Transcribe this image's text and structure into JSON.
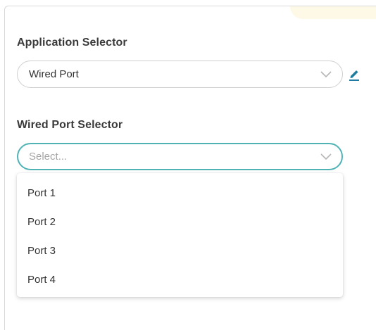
{
  "form": {
    "application_selector": {
      "label": "Application Selector",
      "value": "Wired Port",
      "icon": "chevron-down-icon",
      "edit_icon": "pencil-edit-icon"
    },
    "wired_port_selector": {
      "label": "Wired Port Selector",
      "placeholder": "Select...",
      "icon": "chevron-down-icon",
      "options": [
        "Port 1",
        "Port 2",
        "Port 3",
        "Port 4"
      ]
    }
  },
  "colors": {
    "focus_border": "#4fb3b6",
    "accent": "#1f7c9e",
    "label": "#3a3a3a",
    "placeholder": "#a6a6a6"
  }
}
